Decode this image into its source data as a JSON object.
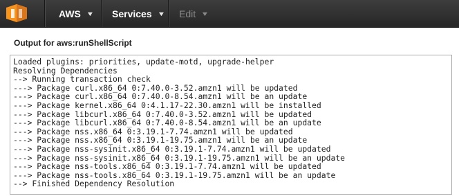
{
  "nav": {
    "logo": "aws-logo-icon",
    "aws_label": "AWS",
    "services_label": "Services",
    "edit_label": "Edit"
  },
  "output": {
    "title": "Output for aws:runShellScript",
    "lines": [
      "Loaded plugins: priorities, update-motd, upgrade-helper",
      "Resolving Dependencies",
      "--> Running transaction check",
      "---> Package curl.x86_64 0:7.40.0-3.52.amzn1 will be updated",
      "---> Package curl.x86_64 0:7.40.0-8.54.amzn1 will be an update",
      "---> Package kernel.x86_64 0:4.1.17-22.30.amzn1 will be installed",
      "---> Package libcurl.x86_64 0:7.40.0-3.52.amzn1 will be updated",
      "---> Package libcurl.x86_64 0:7.40.0-8.54.amzn1 will be an update",
      "---> Package nss.x86_64 0:3.19.1-7.74.amzn1 will be updated",
      "---> Package nss.x86_64 0:3.19.1-19.75.amzn1 will be an update",
      "---> Package nss-sysinit.x86_64 0:3.19.1-7.74.amzn1 will be updated",
      "---> Package nss-sysinit.x86_64 0:3.19.1-19.75.amzn1 will be an update",
      "---> Package nss-tools.x86_64 0:3.19.1-7.74.amzn1 will be updated",
      "---> Package nss-tools.x86_64 0:3.19.1-19.75.amzn1 will be an update",
      "--> Finished Dependency Resolution"
    ]
  },
  "colors": {
    "logo_orange": "#f7941e",
    "topbar": "#2f2f2f"
  }
}
